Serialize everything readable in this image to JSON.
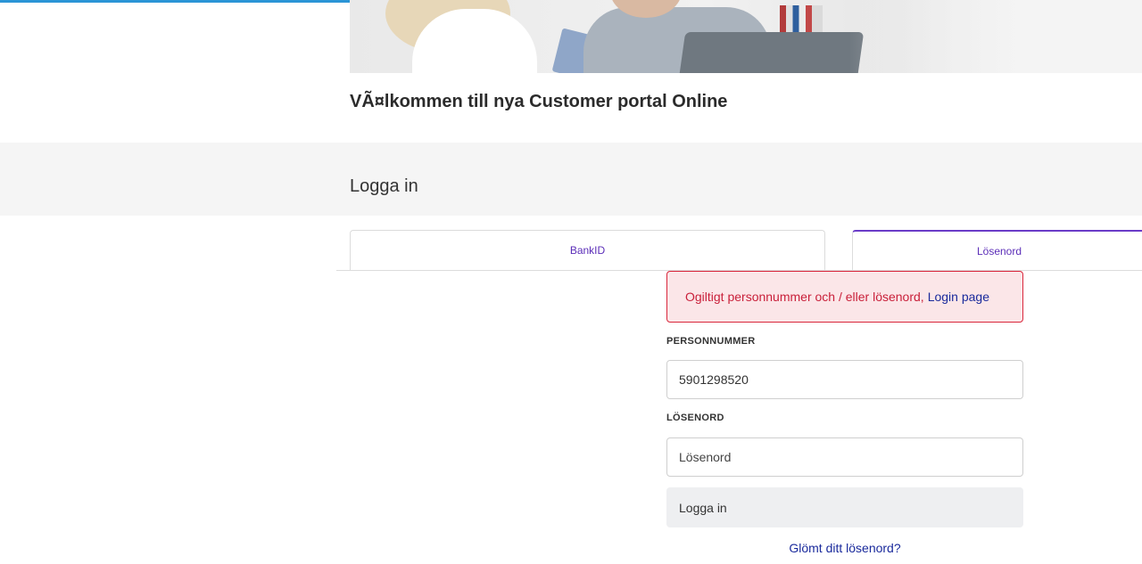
{
  "header": {
    "welcome_title": "VÃ¤lkommen till nya Customer portal Online"
  },
  "login_section": {
    "title": "Logga in"
  },
  "tabs": [
    {
      "label": "BankID",
      "active": false
    },
    {
      "label": "Lösenord",
      "active": true
    }
  ],
  "alert": {
    "message": "Ogiltigt personnummer och / eller lösenord,",
    "link_text": "Login page"
  },
  "form": {
    "personnummer_label": "PERSONNUMMER",
    "personnummer_value": "5901298520",
    "password_label": "LÖSENORD",
    "password_placeholder": "Lösenord",
    "submit_label": "Logga in",
    "forgot_link": "Glömt ditt lösenord?"
  },
  "colors": {
    "accent_bar": "#2b95d6",
    "tab_text": "#5b2db8",
    "error_text": "#c9203a",
    "error_bg": "#fbe6e8",
    "link": "#1a2a9c"
  }
}
